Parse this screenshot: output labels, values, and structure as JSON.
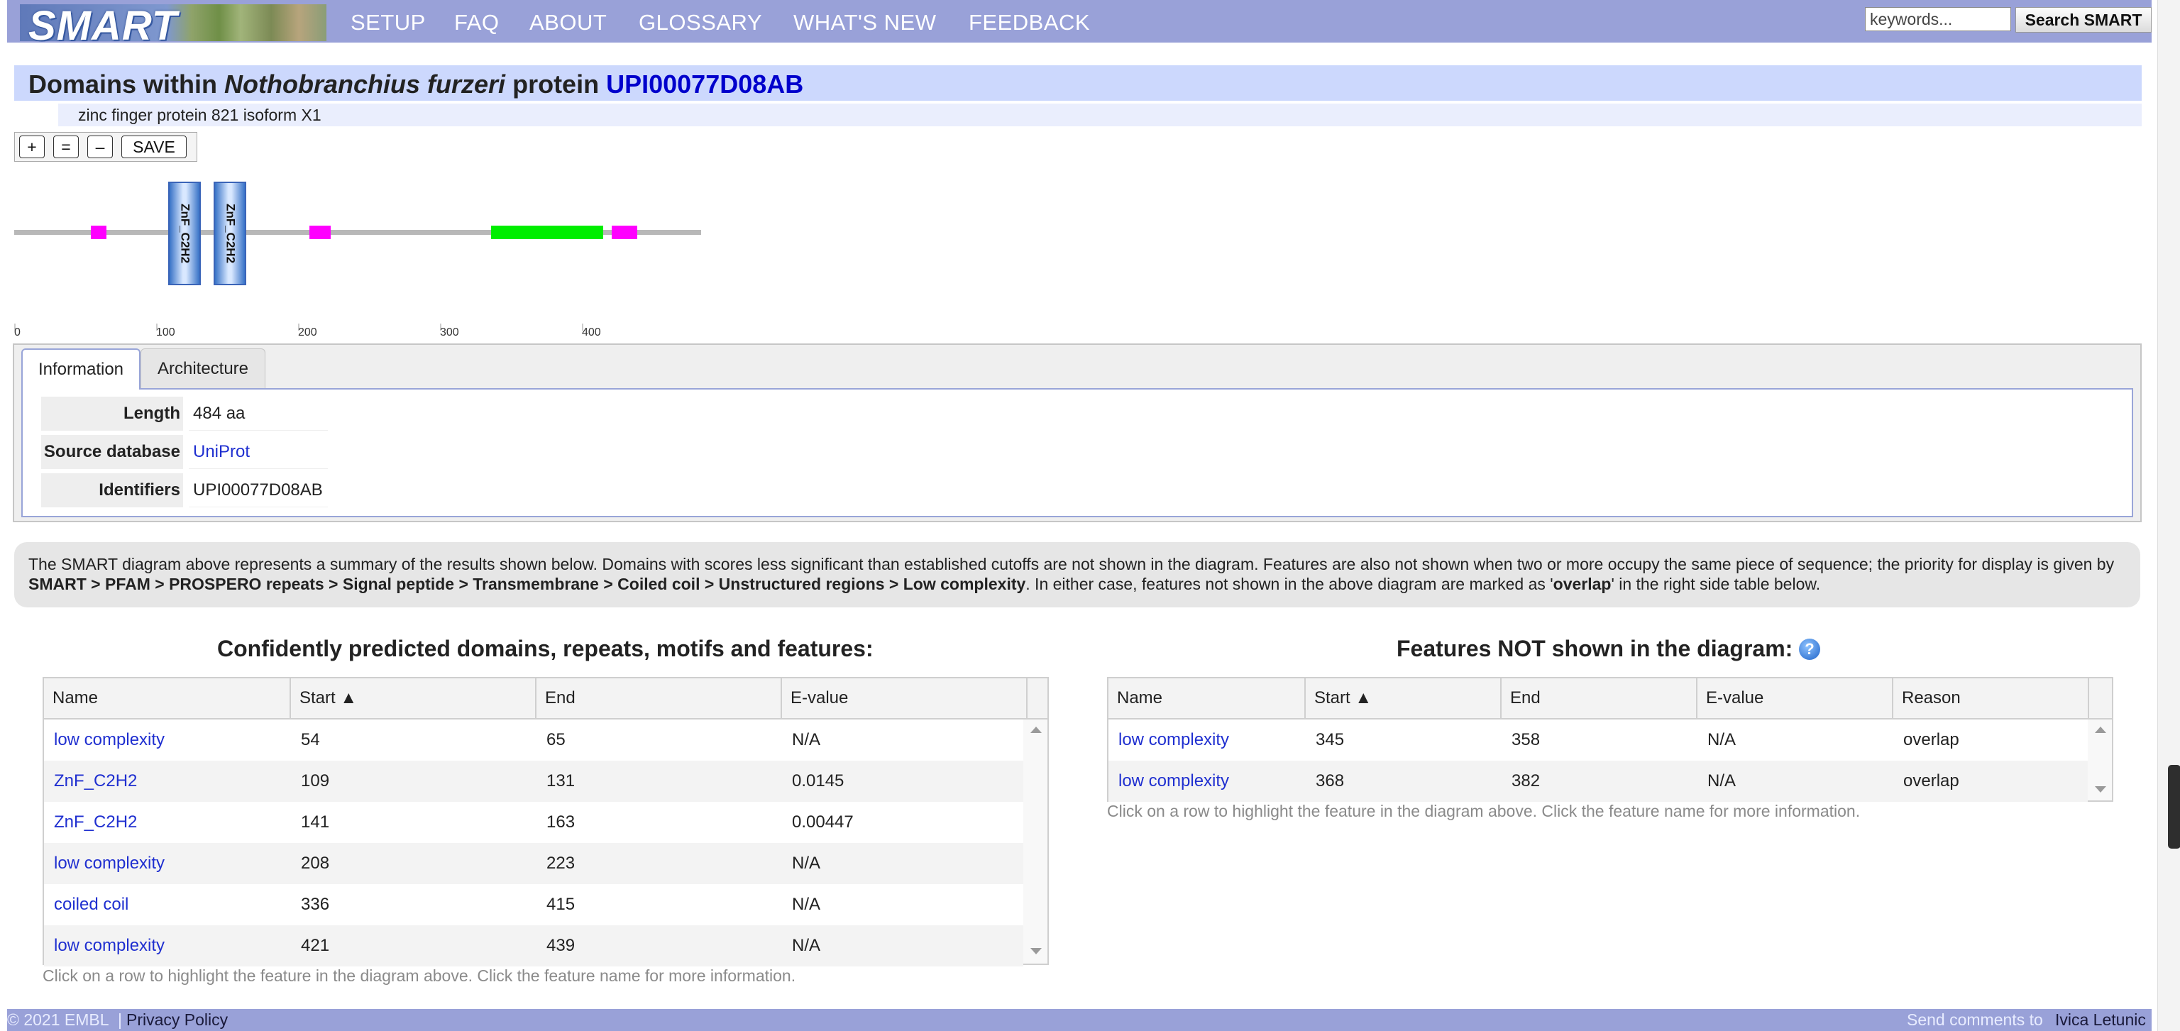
{
  "logo": {
    "text": "SMART"
  },
  "nav": {
    "items": [
      "SETUP",
      "FAQ",
      "ABOUT",
      "GLOSSARY",
      "WHAT'S NEW",
      "FEEDBACK"
    ]
  },
  "search": {
    "placeholder": "keywords...",
    "button_label": "Search SMART"
  },
  "header": {
    "title_prefix": "Domains within",
    "organism": "Nothobranchius furzeri",
    "title_mid": "protein",
    "protein_id": "UPI00077D08AB",
    "subtitle": "zinc finger protein 821 isoform X1"
  },
  "zoom": {
    "plus": "+",
    "equal": "=",
    "minus": "–",
    "save": "SAVE"
  },
  "diagram": {
    "protein_length": 484,
    "scale_labels": [
      "0",
      "100",
      "200",
      "300",
      "400"
    ],
    "features": [
      {
        "type": "low complexity",
        "start": 54,
        "end": 65,
        "color": "#ff00ff"
      },
      {
        "type": "domain",
        "label": "ZnF_C2H2",
        "start": 109,
        "end": 131,
        "color": "#4f8ad9"
      },
      {
        "type": "domain",
        "label": "ZnF_C2H2",
        "start": 141,
        "end": 163,
        "color": "#4f8ad9"
      },
      {
        "type": "low complexity",
        "start": 208,
        "end": 223,
        "color": "#ff00ff"
      },
      {
        "type": "coiled coil",
        "start": 336,
        "end": 415,
        "color": "#00ee00"
      },
      {
        "type": "low complexity",
        "start": 421,
        "end": 439,
        "color": "#ff00ff"
      }
    ]
  },
  "info": {
    "tabs": [
      "Information",
      "Architecture"
    ],
    "rows": [
      {
        "label": "Length",
        "value": "484 aa"
      },
      {
        "label": "Source database",
        "value": "UniProt"
      },
      {
        "label": "Identifiers",
        "value": "UPI00077D08AB"
      }
    ]
  },
  "note": {
    "part1": "The SMART diagram above represents a summary of the results shown below. Domains with scores less significant than established cutoffs are not shown in the diagram. Features are also not shown when two or more occupy the same piece of sequence; the priority for display is given by ",
    "priority": "SMART > PFAM > PROSPERO repeats > Signal peptide > Transmembrane > Coiled coil > Unstructured regions > Low complexity",
    "part2": ". In either case, features not shown in the above diagram are marked as '",
    "overlap_word": "overlap",
    "part3": "' in the right side table below."
  },
  "left_table": {
    "title": "Confidently predicted domains, repeats, motifs and features:",
    "columns": [
      "Name",
      "Start ▲",
      "End",
      "E-value"
    ],
    "rows": [
      {
        "name": "low complexity",
        "start": "54",
        "end": "65",
        "evalue": "N/A"
      },
      {
        "name": "ZnF_C2H2",
        "start": "109",
        "end": "131",
        "evalue": "0.0145"
      },
      {
        "name": "ZnF_C2H2",
        "start": "141",
        "end": "163",
        "evalue": "0.00447"
      },
      {
        "name": "low complexity",
        "start": "208",
        "end": "223",
        "evalue": "N/A"
      },
      {
        "name": "coiled coil",
        "start": "336",
        "end": "415",
        "evalue": "N/A"
      },
      {
        "name": "low complexity",
        "start": "421",
        "end": "439",
        "evalue": "N/A"
      }
    ],
    "hint": "Click on a row to highlight the feature in the diagram above. Click the feature name for more information."
  },
  "right_table": {
    "title": "Features NOT shown in the diagram:",
    "columns": [
      "Name",
      "Start ▲",
      "End",
      "E-value",
      "Reason"
    ],
    "rows": [
      {
        "name": "low complexity",
        "start": "345",
        "end": "358",
        "evalue": "N/A",
        "reason": "overlap"
      },
      {
        "name": "low complexity",
        "start": "368",
        "end": "382",
        "evalue": "N/A",
        "reason": "overlap"
      }
    ],
    "hint": "Click on a row to highlight the feature in the diagram above. Click the feature name for more information."
  },
  "footer": {
    "copyright": "© 2021 EMBL",
    "separator": "|",
    "privacy": "Privacy Policy",
    "send_comments": "Send comments to",
    "contact_name": "Ivica Letunic"
  }
}
